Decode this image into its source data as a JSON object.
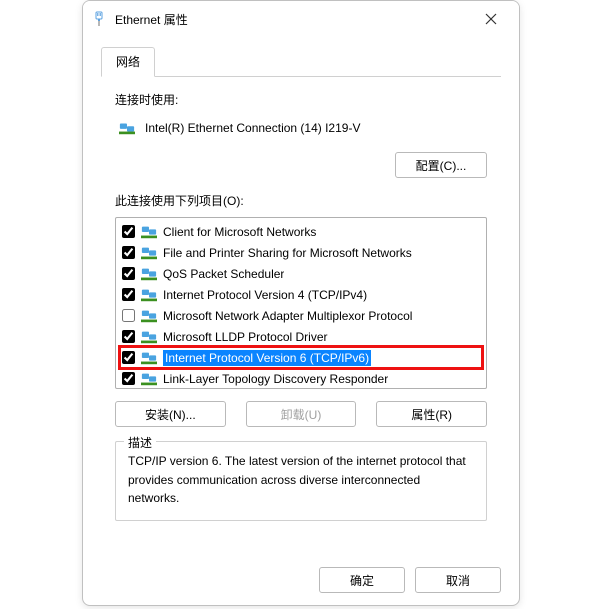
{
  "window": {
    "title": "Ethernet 属性"
  },
  "tab": {
    "network": "网络"
  },
  "labels": {
    "connect_using": "连接时使用:",
    "items_used": "此连接使用下列项目(O):",
    "description_title": "描述"
  },
  "adapter": {
    "name": "Intel(R) Ethernet Connection (14) I219-V"
  },
  "buttons": {
    "configure": "配置(C)...",
    "install": "安装(N)...",
    "uninstall": "卸载(U)",
    "properties": "属性(R)",
    "ok": "确定",
    "cancel": "取消"
  },
  "items": [
    {
      "label": "Client for Microsoft Networks",
      "checked": true,
      "selected": false
    },
    {
      "label": "File and Printer Sharing for Microsoft Networks",
      "checked": true,
      "selected": false
    },
    {
      "label": "QoS Packet Scheduler",
      "checked": true,
      "selected": false
    },
    {
      "label": "Internet Protocol Version 4 (TCP/IPv4)",
      "checked": true,
      "selected": false
    },
    {
      "label": "Microsoft Network Adapter Multiplexor Protocol",
      "checked": false,
      "selected": false
    },
    {
      "label": "Microsoft LLDP Protocol Driver",
      "checked": true,
      "selected": false
    },
    {
      "label": "Internet Protocol Version 6 (TCP/IPv6)",
      "checked": true,
      "selected": true,
      "highlighted": true
    },
    {
      "label": "Link-Layer Topology Discovery Responder",
      "checked": true,
      "selected": false
    }
  ],
  "description": {
    "text": "TCP/IP version 6. The latest version of the internet protocol that provides communication across diverse interconnected networks."
  }
}
